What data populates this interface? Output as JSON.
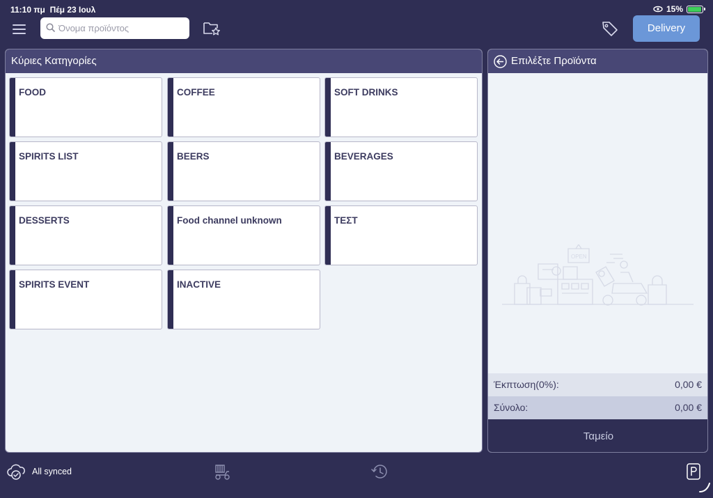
{
  "status_bar": {
    "time": "11:10 πμ",
    "date": "Πέμ 23 Ιουλ",
    "battery": "15%"
  },
  "toolbar": {
    "search_placeholder": "Όνομα προϊόντος",
    "delivery_label": "Delivery"
  },
  "categories": {
    "title": "Κύριες Κατηγορίες",
    "items": [
      {
        "label": "FOOD"
      },
      {
        "label": "COFFEE"
      },
      {
        "label": "SOFT DRINKS"
      },
      {
        "label": "SPIRITS LIST"
      },
      {
        "label": "BEERS"
      },
      {
        "label": "BEVERAGES"
      },
      {
        "label": "DESSERTS"
      },
      {
        "label": "Food channel unknown"
      },
      {
        "label": "ΤΕΣΤ"
      },
      {
        "label": "SPIRITS EVENT"
      },
      {
        "label": "INACTIVE"
      }
    ]
  },
  "order_panel": {
    "title": "Επιλέξτε Προϊόντα",
    "illustration_sign": "OPEN",
    "discount_label": "Έκπτωση(0%):",
    "discount_value": "0,00 €",
    "total_label": "Σύνολο:",
    "total_value": "0,00 €",
    "checkout_label": "Ταμείο"
  },
  "bottom_bar": {
    "sync_label": "All synced"
  },
  "colors": {
    "primary_dark": "#2f2e54",
    "header": "#484775",
    "accent": "#6b97d8",
    "background": "#eff3f8"
  }
}
